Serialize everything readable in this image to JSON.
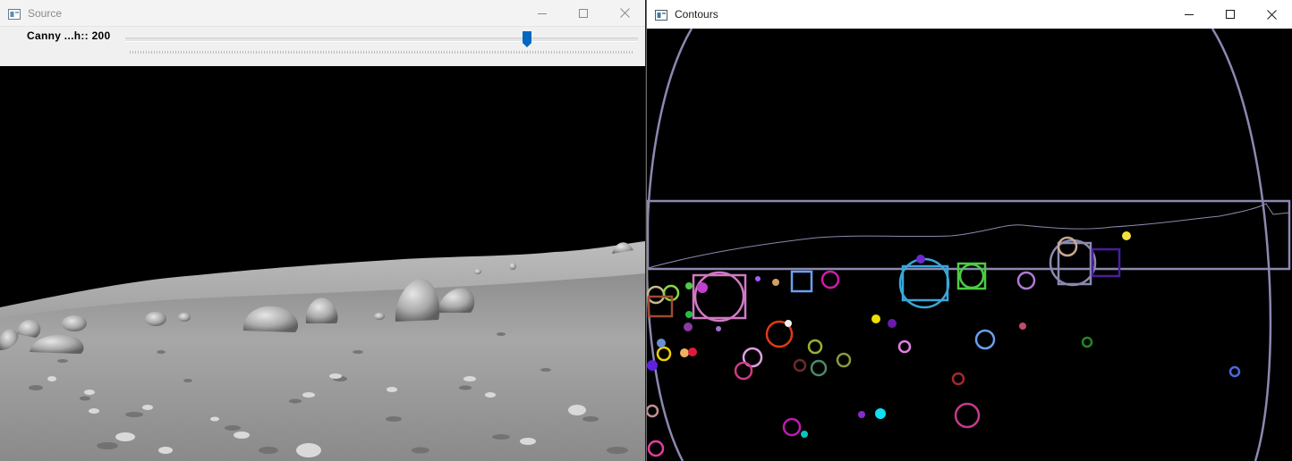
{
  "source_window": {
    "title": "Source",
    "icon": "opencv-window-icon",
    "trackbar": {
      "label": "Canny ...h:: 200",
      "value": 200,
      "max": 255
    },
    "image": "grayscale lunar surface with boulders and distant hills under black sky"
  },
  "contours_window": {
    "title": "Contours",
    "icon": "opencv-window-icon",
    "canvas": "colored contours with bounding boxes and enclosing circles on black background"
  },
  "caption_buttons": [
    "minimize-icon",
    "maximize-icon",
    "close-icon"
  ],
  "colors": {
    "slider_thumb": "#0067c0",
    "hull_lines": "#8b89b0",
    "inactive_title": "#8a8a8a"
  }
}
